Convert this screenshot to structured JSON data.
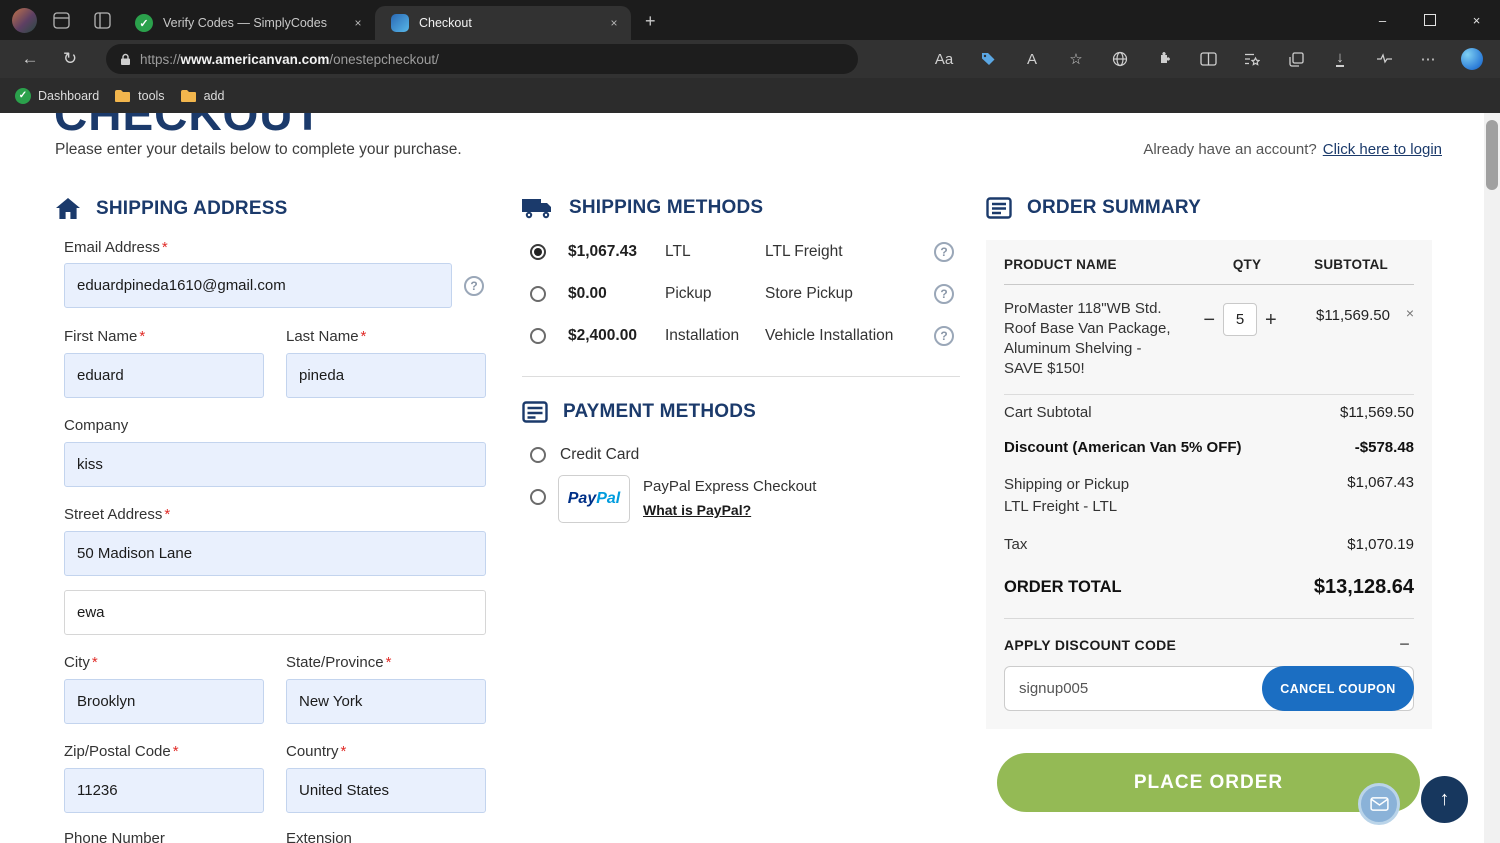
{
  "browser": {
    "tabs": [
      {
        "title": "Verify Codes — SimplyCodes"
      },
      {
        "title": "Checkout",
        "active": true
      }
    ],
    "url": {
      "scheme": "https://",
      "host": "www.americanvan.com",
      "path": "/onestepcheckout/"
    },
    "bookmarks": [
      "Dashboard",
      "tools",
      "add"
    ]
  },
  "glyphs": {
    "back": "←",
    "refresh": "↻",
    "translate": "Aa",
    "read_aloud": "A",
    "favorite": "☆",
    "download": "↓",
    "more": "⋯",
    "new_tab": "+",
    "close": "×",
    "minimize": "–",
    "up": "↑",
    "minus": "−",
    "plus": "+",
    "question": "?",
    "remove": "×",
    "check": "✓"
  },
  "page": {
    "title": "CHECKOUT",
    "subtitle": "Please enter your details below to complete your purchase.",
    "login_prompt": "Already have an account?",
    "login_link": "Click here to login",
    "required_mark": "*"
  },
  "shipping_address": {
    "heading": "SHIPPING ADDRESS",
    "email_label": "Email Address",
    "email_value": "eduardpineda1610@gmail.com",
    "first_name_label": "First Name",
    "first_name_value": "eduard",
    "last_name_label": "Last Name",
    "last_name_value": "pineda",
    "company_label": "Company",
    "company_value": "kiss",
    "street_label": "Street Address",
    "street_value": "50 Madison Lane",
    "street2_value": "ewa",
    "city_label": "City",
    "city_value": "Brooklyn",
    "state_label": "State/Province",
    "state_value": "New York",
    "zip_label": "Zip/Postal Code",
    "zip_value": "11236",
    "country_label": "Country",
    "country_value": "United States",
    "phone_label": "Phone Number",
    "extension_label": "Extension"
  },
  "shipping_methods": {
    "heading": "SHIPPING METHODS",
    "options": [
      {
        "price": "$1,067.43",
        "name": "LTL",
        "description": "LTL Freight",
        "selected": true
      },
      {
        "price": "$0.00",
        "name": "Pickup",
        "description": "Store Pickup",
        "selected": false
      },
      {
        "price": "$2,400.00",
        "name": "Installation",
        "description": "Vehicle Installation",
        "selected": false
      }
    ]
  },
  "payment_methods": {
    "heading": "PAYMENT METHODS",
    "credit_card_label": "Credit Card",
    "paypal_label": "PayPal Express Checkout",
    "paypal_link": "What is PayPal?",
    "paypal_logo": {
      "pay": "Pay",
      "pal": "Pal"
    }
  },
  "order_summary": {
    "heading": "ORDER SUMMARY",
    "columns": {
      "product": "PRODUCT NAME",
      "qty": "QTY",
      "subtotal": "SUBTOTAL"
    },
    "item": {
      "name": "ProMaster 118\"WB Std. Roof Base Van Package, Aluminum Shelving - SAVE $150!",
      "qty": "5",
      "subtotal": "$11,569.50"
    },
    "rows": [
      {
        "label": "Cart Subtotal",
        "value": "$11,569.50"
      },
      {
        "label": "Discount (American Van 5% OFF)",
        "value": "-$578.48"
      },
      {
        "label": "Shipping or Pickup",
        "sublabel": "LTL Freight - LTL",
        "value": "$1,067.43"
      },
      {
        "label": "Tax",
        "value": "$1,070.19"
      },
      {
        "label": "ORDER TOTAL",
        "value": "$13,128.64"
      }
    ],
    "discount": {
      "heading": "APPLY DISCOUNT CODE",
      "code": "signup005",
      "button": "CANCEL COUPON"
    },
    "place_order": "PLACE ORDER"
  },
  "colors": {
    "heading_navy": "#1b3a6b",
    "place_order_green": "#94ba55",
    "coupon_blue": "#1b6ec2",
    "autofill_field": "#e9f0fd",
    "required_red": "#e02b27"
  }
}
